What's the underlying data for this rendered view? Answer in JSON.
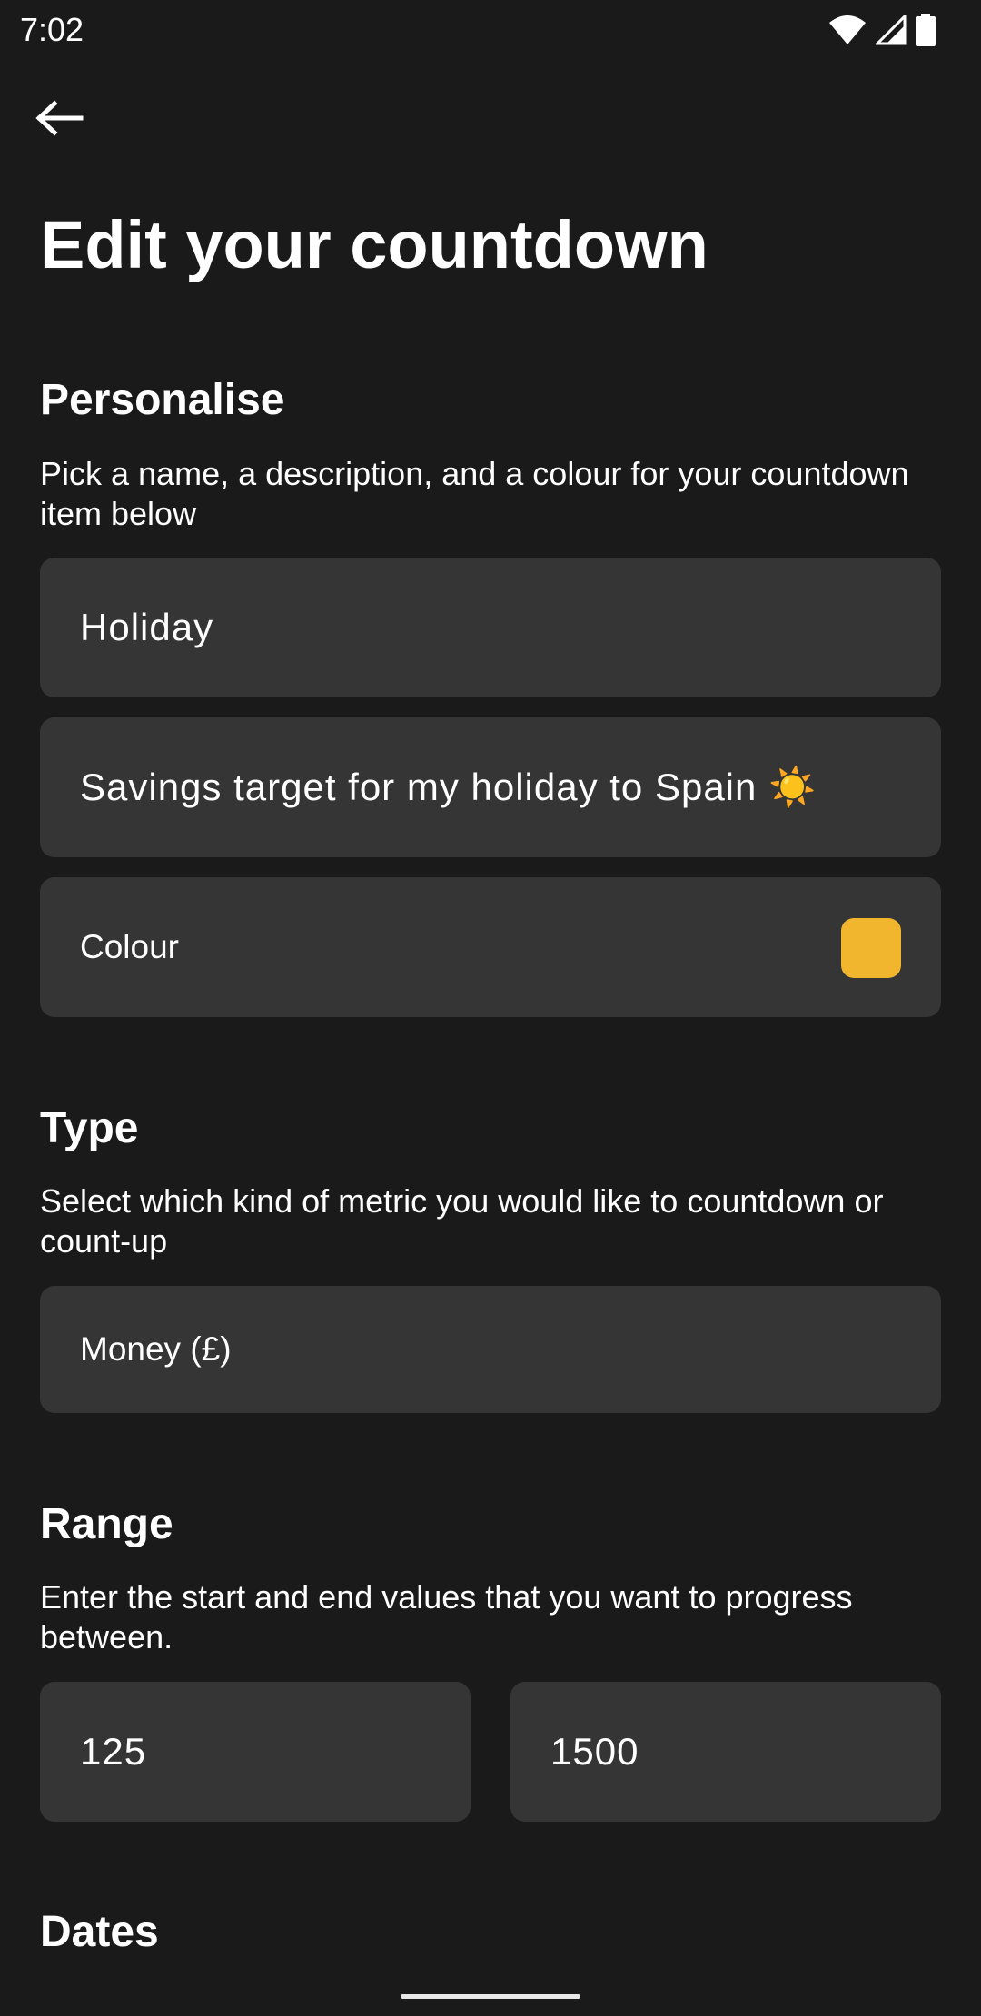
{
  "status_bar": {
    "time": "7:02",
    "icons": [
      "wifi-icon",
      "cellular-signal-icon",
      "battery-icon"
    ]
  },
  "nav": {
    "back_icon": "arrow-left-icon"
  },
  "page": {
    "title": "Edit your countdown"
  },
  "personalise": {
    "title": "Personalise",
    "description": "Pick a name, a description, and a colour for your countdown item below",
    "name_value": "Holiday",
    "description_value": "Savings target for my holiday to Spain ☀️",
    "colour_label": "Colour",
    "colour_value": "#f1b62e"
  },
  "type": {
    "title": "Type",
    "description": "Select which kind of metric you would like to countdown or count-up",
    "selected": "Money (£)"
  },
  "range": {
    "title": "Range",
    "description": "Enter the start and end values that you want to progress between.",
    "start_value": "125",
    "end_value": "1500"
  },
  "dates": {
    "title": "Dates"
  },
  "colors": {
    "background": "#1a1a1a",
    "field_background": "#353535",
    "text": "#ffffff"
  }
}
